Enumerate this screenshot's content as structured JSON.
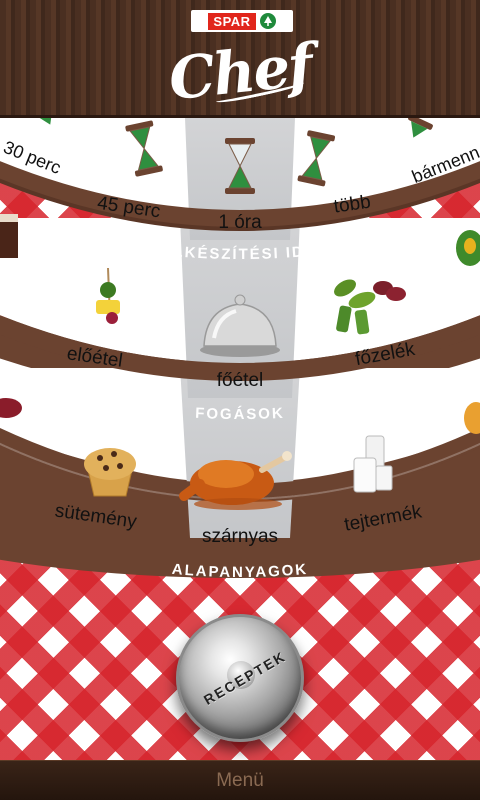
{
  "header": {
    "brand": "SPAR",
    "app_title": "Chef"
  },
  "dials": [
    {
      "name": "ELKÉSZÍTÉSI IDŐ",
      "items": [
        "30 perc",
        "45 perc",
        "1 óra",
        "több",
        "bármenn"
      ],
      "selected": "1 óra"
    },
    {
      "name": "FOGÁSOK",
      "items": [
        "előétel",
        "főétel",
        "főzelék"
      ],
      "selected": "főétel"
    },
    {
      "name": "ALAPANYAGOK",
      "items": [
        "sütemény",
        "szárnyas",
        "tejtermék"
      ],
      "selected": "szárnyas"
    }
  ],
  "bell_button": {
    "label": "RECEPTEK"
  },
  "footer": {
    "menu_label": "Menü"
  },
  "colors": {
    "brand_red": "#e1261c",
    "wood": "#4a2f21",
    "ring_brown": "#6b4330",
    "tablecloth_red": "#d6242c"
  }
}
